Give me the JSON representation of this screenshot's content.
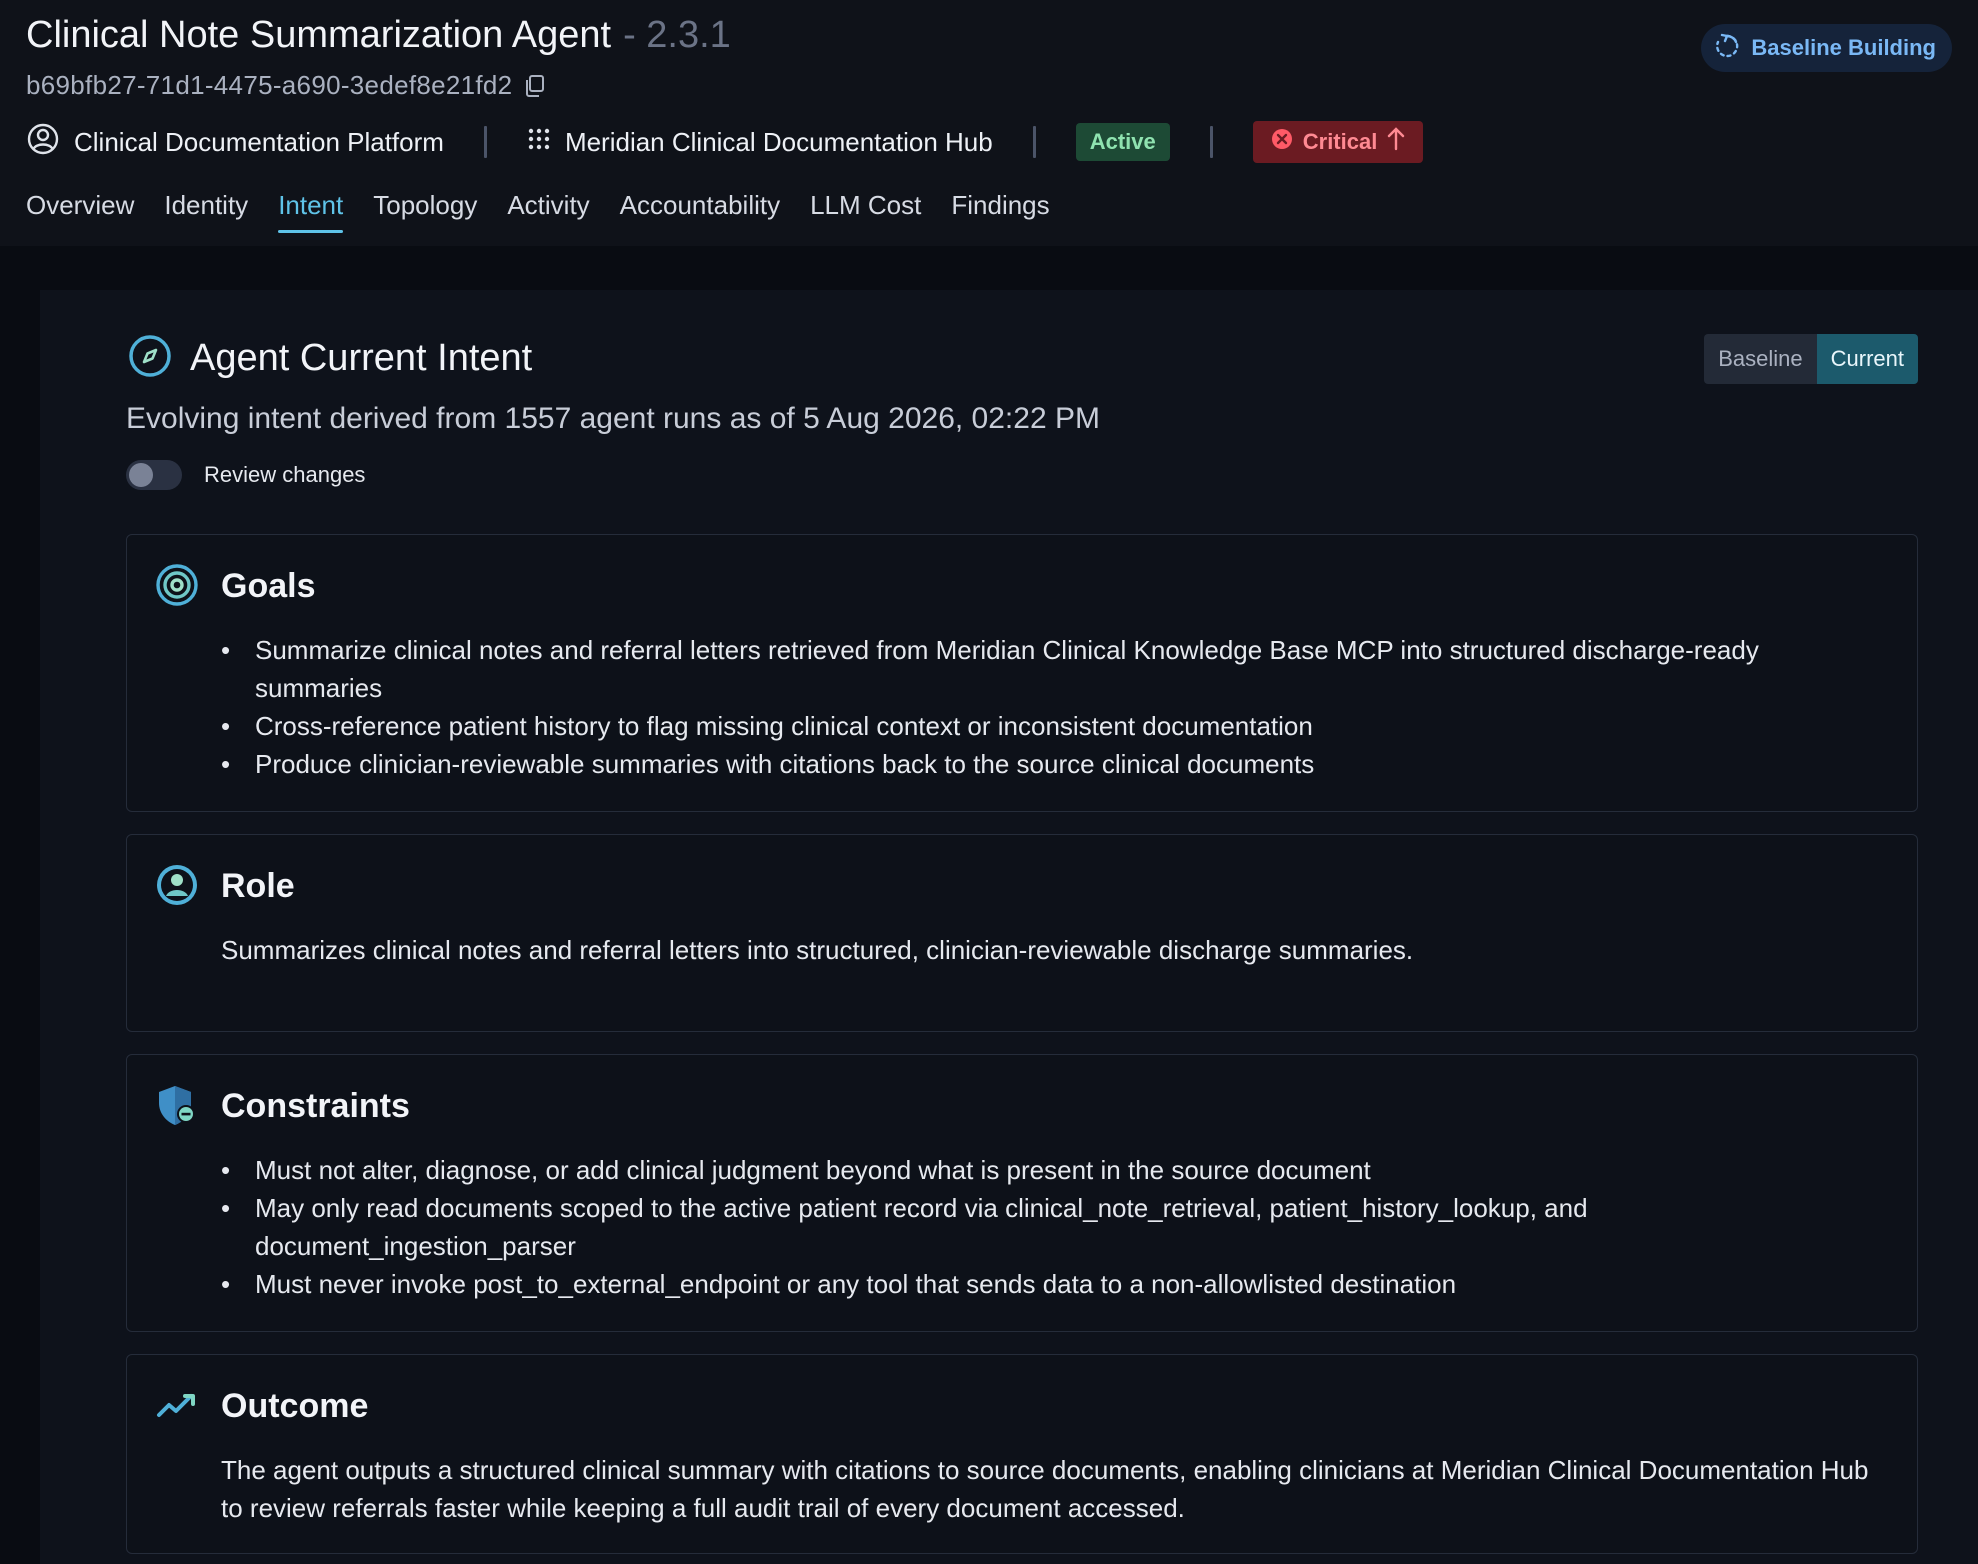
{
  "header": {
    "title": "Clinical Note Summarization Agent",
    "version": "- 2.3.1",
    "agent_id": "b69bfb27-71d1-4475-a690-3edef8e21fd2",
    "status_pill": "Baseline Building",
    "platform": "Clinical Documentation Platform",
    "hub": "Meridian Clinical Documentation Hub",
    "state_badge": "Active",
    "severity_badge": "Critical"
  },
  "tabs": [
    {
      "label": "Overview",
      "active": false
    },
    {
      "label": "Identity",
      "active": false
    },
    {
      "label": "Intent",
      "active": true
    },
    {
      "label": "Topology",
      "active": false
    },
    {
      "label": "Activity",
      "active": false
    },
    {
      "label": "Accountability",
      "active": false
    },
    {
      "label": "LLM Cost",
      "active": false
    },
    {
      "label": "Findings",
      "active": false
    }
  ],
  "intent": {
    "title": "Agent Current Intent",
    "subtitle": "Evolving intent derived from 1557 agent runs as of 5 Aug 2026, 02:22 PM",
    "toggle_label": "Review changes",
    "toggle_on": false,
    "view_options": [
      "Baseline",
      "Current"
    ],
    "selected_view": "Current"
  },
  "sections": {
    "goals": {
      "title": "Goals",
      "items": [
        "Summarize clinical notes and referral letters retrieved from Meridian Clinical Knowledge Base MCP into structured discharge-ready summaries",
        "Cross-reference patient history to flag missing clinical context or inconsistent documentation",
        "Produce clinician-reviewable summaries with citations back to the source clinical documents"
      ]
    },
    "role": {
      "title": "Role",
      "text": "Summarizes clinical notes and referral letters into structured, clinician-reviewable discharge summaries."
    },
    "constraints": {
      "title": "Constraints",
      "items": [
        "Must not alter, diagnose, or add clinical judgment beyond what is present in the source document",
        "May only read documents scoped to the active patient record via clinical_note_retrieval, patient_history_lookup, and document_ingestion_parser",
        "Must never invoke post_to_external_endpoint or any tool that sends data to a non-allowlisted destination"
      ]
    },
    "outcome": {
      "title": "Outcome",
      "text": "The agent outputs a structured clinical summary with citations to source documents, enabling clinicians at Meridian Clinical Documentation Hub to review referrals faster while keeping a full audit trail of every document accessed."
    }
  },
  "colors": {
    "accent": "#5fc3e8",
    "active_badge_bg": "#1d4a35",
    "critical_badge_bg": "#6b1b22",
    "background": "#0b0f17"
  }
}
